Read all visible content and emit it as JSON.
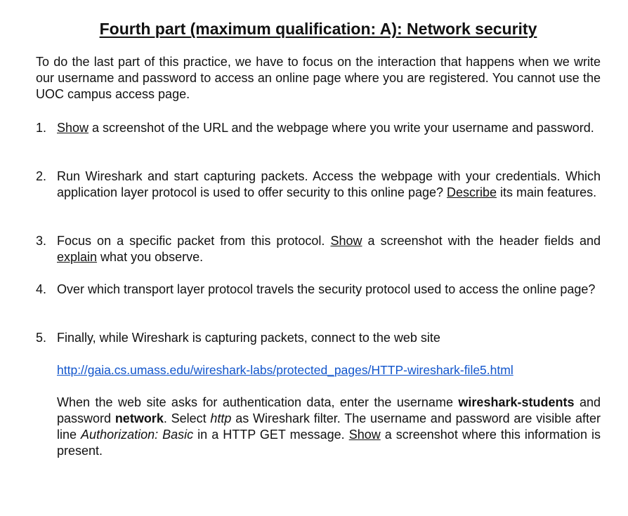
{
  "title": "Fourth part (maximum qualification: A): Network security",
  "intro": "To do the last part of this practice, we have to focus on the interaction that happens when we write our username and password to access an online page where you are registered. You cannot use the UOC campus access page.",
  "items": [
    {
      "num": "1.",
      "verb": "Show",
      "text": " a screenshot of the URL and the webpage where you write your username and password."
    },
    {
      "num": "2.",
      "text_a": "Run Wireshark and start capturing packets. Access the webpage with your credentials. Which application layer protocol is used to offer security to this online page? ",
      "verb": "Describe",
      "text_b": " its main features."
    },
    {
      "num": "3.",
      "text_a": "Focus on a specific packet from this protocol. ",
      "verb1": "Show",
      "text_b": " a screenshot with the header fields and ",
      "verb2": "explain",
      "text_c": " what you observe."
    },
    {
      "num": "4.",
      "text": "Over which transport layer protocol travels the security protocol used to access the online page?"
    },
    {
      "num": "5.",
      "text": "Finally, while Wireshark is capturing packets, connect to the web site",
      "link": "http://gaia.cs.umass.edu/wireshark-labs/protected_pages/HTTP-wireshark-file5.html",
      "p_a": "When the web site asks for authentication data, enter the username ",
      "username": "wireshark-students",
      "p_b": " and password ",
      "password": "network",
      "p_c": ". Select ",
      "filter": "http",
      "p_d": " as Wireshark filter. The username and password are visible after line ",
      "auth_line": "Authorization: Basic",
      "p_e": " in a HTTP GET message. ",
      "verb": "Show",
      "p_f": " a screenshot where this information is present."
    }
  ],
  "colors": {
    "link": "#1155cc",
    "text": "#111111"
  }
}
